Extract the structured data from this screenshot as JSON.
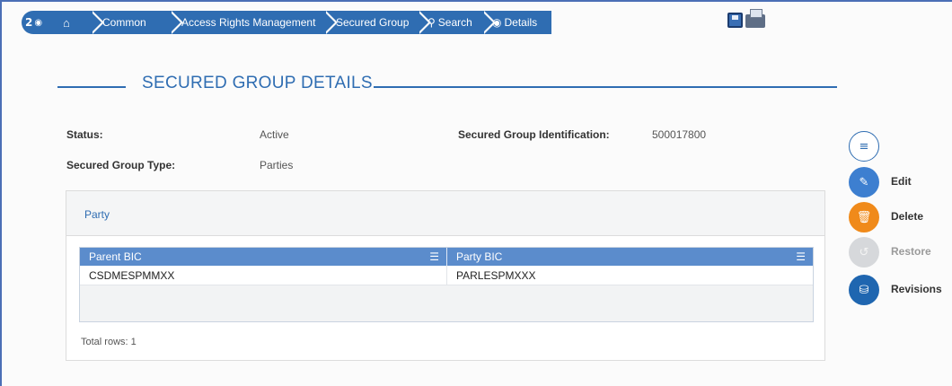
{
  "breadcrumb": {
    "count": "2",
    "items": [
      {
        "label": "Common"
      },
      {
        "label": "Access Rights Management"
      },
      {
        "label": "Secured Group"
      },
      {
        "label": "Search"
      },
      {
        "label": "Details"
      }
    ]
  },
  "page": {
    "title": "SECURED GROUP DETAILS"
  },
  "details": {
    "status_label": "Status:",
    "status_value": "Active",
    "id_label": "Secured Group Identification:",
    "id_value": "500017800",
    "type_label": "Secured Group Type:",
    "type_value": "Parties"
  },
  "panel": {
    "tab_label": "Party",
    "columns": [
      "Parent BIC",
      "Party BIC"
    ],
    "rows": [
      [
        "CSDMESPMMXX",
        "PARLESPMXXX"
      ]
    ],
    "total_rows": "Total rows: 1"
  },
  "actions": {
    "edit": "Edit",
    "delete": "Delete",
    "restore": "Restore",
    "revisions": "Revisions"
  },
  "icons": [
    "home-icon",
    "eye-icon",
    "search-icon",
    "save-icon",
    "print-icon",
    "list-icon",
    "edit-icon",
    "trash-icon",
    "restore-icon",
    "database-icon",
    "menu-icon"
  ],
  "colors": {
    "accent": "#2f6db2",
    "grid_header": "#5b8ccc",
    "delete": "#f08a1a",
    "restore_disabled": "#d6d8db"
  }
}
